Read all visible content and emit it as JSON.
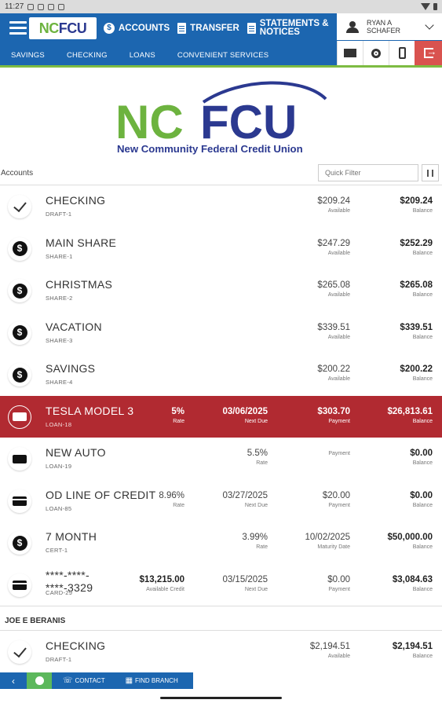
{
  "statusbar": {
    "time": "11:27"
  },
  "header": {
    "logo_nc": "NC",
    "logo_fcu": "FCU",
    "nav": [
      {
        "label": "ACCOUNTS"
      },
      {
        "label": "TRANSFER"
      },
      {
        "label_line1": "STATEMENTS &",
        "label_line2": "NOTICES"
      }
    ],
    "subnav": [
      "SAVINGS",
      "CHECKING",
      "LOANS",
      "CONVENIENT SERVICES"
    ],
    "user": {
      "line1": "RYAN A",
      "line2": "SCHAFER"
    }
  },
  "brand": {
    "nc": "NC",
    "fcu": "FCU",
    "full_name": "New Community Federal Credit Union",
    "green": "#6db33f",
    "blue": "#2b3990"
  },
  "accounts_label": "Accounts",
  "quick_filter_placeholder": "Quick Filter",
  "accounts": [
    {
      "icon": "check",
      "name": "CHECKING",
      "sub": "DRAFT-1",
      "c3v": "$209.24",
      "c3l": "Available",
      "c4v": "$209.24",
      "c4l": "Balance"
    },
    {
      "icon": "dollar",
      "name": "MAIN SHARE",
      "sub": "SHARE-1",
      "c3v": "$247.29",
      "c3l": "Available",
      "c4v": "$252.29",
      "c4l": "Balance"
    },
    {
      "icon": "dollar",
      "name": "CHRISTMAS",
      "sub": "SHARE-2",
      "c3v": "$265.08",
      "c3l": "Available",
      "c4v": "$265.08",
      "c4l": "Balance"
    },
    {
      "icon": "dollar",
      "name": "VACATION",
      "sub": "SHARE-3",
      "c3v": "$339.51",
      "c3l": "Available",
      "c4v": "$339.51",
      "c4l": "Balance"
    },
    {
      "icon": "dollar",
      "name": "SAVINGS",
      "sub": "SHARE-4",
      "c3v": "$200.22",
      "c3l": "Available",
      "c4v": "$200.22",
      "c4l": "Balance"
    },
    {
      "icon": "ticket",
      "name": "TESLA MODEL 3",
      "sub": "LOAN-18",
      "c1v": "5%",
      "c1l": "Rate",
      "c2v": "03/06/2025",
      "c2l": "Next Due",
      "c3v": "$303.70",
      "c3l": "Payment",
      "c4v": "$26,813.61",
      "c4l": "Balance",
      "highlight": true
    },
    {
      "icon": "ticket",
      "name": "NEW AUTO",
      "sub": "LOAN-19",
      "c2v": "5.5%",
      "c2l": "Rate",
      "c3v": "",
      "c3l": "Payment",
      "c4v": "$0.00",
      "c4l": "Balance"
    },
    {
      "icon": "card",
      "name": "OD LINE OF CREDIT",
      "sub": "LOAN-85",
      "c1v": "8.96%",
      "c1l": "Rate",
      "c2v": "03/27/2025",
      "c2l": "Next Due",
      "c3v": "$20.00",
      "c3l": "Payment",
      "c4v": "$0.00",
      "c4l": "Balance"
    },
    {
      "icon": "dollar",
      "name": "7 MONTH",
      "sub": "CERT-1",
      "c2v": "3.99%",
      "c2l": "Rate",
      "c3v": "10/02/2025",
      "c3l": "Maturity Date",
      "c4v": "$50,000.00",
      "c4l": "Balance"
    },
    {
      "icon": "card",
      "name_line1": "****-****-",
      "name_line2": "****-3329",
      "sub": "CARD-29",
      "c1v": "$13,215.00",
      "c1l": "Available Credit",
      "c2v": "03/15/2025",
      "c2l": "Next Due",
      "c3v": "$0.00",
      "c3l": "Payment",
      "c4v": "$3,084.63",
      "c4l": "Balance"
    }
  ],
  "joint_section": {
    "title": "JOE E BERANIS",
    "accounts": [
      {
        "icon": "check",
        "name": "CHECKING",
        "sub": "DRAFT-1",
        "c3v": "$2,194.51",
        "c3l": "Available",
        "c4v": "$2,194.51",
        "c4l": "Balance"
      }
    ]
  },
  "bottombar": {
    "contact": "CONTACT",
    "find_branch": "FIND BRANCH"
  },
  "colors": {
    "primary": "#1c66b0",
    "accent_green": "#7dbb42",
    "highlight_red": "#b12a31",
    "logout_red": "#d9534f"
  }
}
